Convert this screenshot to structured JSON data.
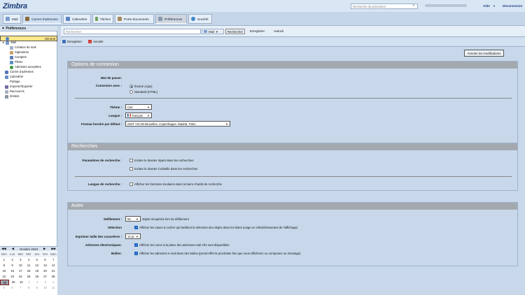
{
  "header": {
    "logo": "Zimbra",
    "people_search_placeholder": "Recherche de personnes",
    "help": "Aide",
    "logout": "Déconnexion"
  },
  "tabs": [
    {
      "label": "Mail",
      "icon": "mail-icon"
    },
    {
      "label": "Carnet d'adresses",
      "icon": "address-book-icon",
      "active": true
    },
    {
      "label": "Calendrier",
      "icon": "calendar-icon"
    },
    {
      "label": "Tâches",
      "icon": "tasks-icon"
    },
    {
      "label": "Porte-documents",
      "icon": "briefcase-icon"
    },
    {
      "label": "Préférences",
      "icon": "preferences-icon"
    },
    {
      "label": "Société",
      "icon": "society-icon"
    }
  ],
  "sidebar": {
    "title": "Préférences",
    "items": [
      {
        "label": "Général",
        "selected": true
      },
      {
        "label": "Mail"
      },
      {
        "label": "Création de mail"
      },
      {
        "label": "Signatures"
      },
      {
        "label": "Comptes"
      },
      {
        "label": "Filtres"
      },
      {
        "label": "Adresses acceptées"
      },
      {
        "label": "Carnet d'adresses"
      },
      {
        "label": "Calendrier"
      },
      {
        "label": "Partage"
      },
      {
        "label": "Importer/Exporter"
      },
      {
        "label": "Raccourcis"
      },
      {
        "label": "Zimlets"
      }
    ]
  },
  "minical": {
    "title": "Octobre 2023",
    "dow": [
      "Dim",
      "Lun",
      "Mar",
      "Mer",
      "Jeu",
      "Ven",
      "Sam"
    ],
    "weeks": [
      [
        "1",
        "2",
        "3",
        "4",
        "5",
        "6",
        "7"
      ],
      [
        "8",
        "9",
        "10",
        "11",
        "12",
        "13",
        "14"
      ],
      [
        "15",
        "16",
        "17",
        "18",
        "19",
        "20",
        "21"
      ],
      [
        "22",
        "23",
        "24",
        "25",
        "26",
        "27",
        "28"
      ],
      [
        "29",
        "30",
        "31",
        "1",
        "2",
        "3",
        "4"
      ],
      [
        "5",
        "6",
        "7",
        "8",
        "9",
        "10",
        "11"
      ]
    ]
  },
  "toolbar": {
    "search_placeholder": "Rechercher",
    "scope": "Mail",
    "search_button": "Rechercher",
    "save_button": "Enregistrer",
    "advanced": "Avancé"
  },
  "actions": {
    "save": "Enregistrer",
    "cancel": "Annuler",
    "undo": "Annuler les modifications"
  },
  "connexion": {
    "title": "Options de connexion",
    "password_label": "Mot de passe:",
    "mode_label": "Connexion avec :",
    "mode_options": [
      "Évolué (Ajax)",
      "Standard (HTML)"
    ],
    "theme_label": "Thème :",
    "theme_value": "Ciel",
    "lang_label": "Langue :",
    "lang_value": "français",
    "tz_label": "Fuseau horaire par défaut :",
    "tz_value": "GMT +01:00 Bruxelles, Copenhague, Madrid, Paris"
  },
  "recherches": {
    "title": "Recherches",
    "params_label": "Paramètres de recherche :",
    "opt_spam": "Inclure le dossier Spam dans les recherches",
    "opt_trash": "Inclure le dossier Corbeille dans les recherches",
    "lang_label": "Langue de recherche :",
    "opt_lang": "Afficher les fonctions évoluées dans la barre d'outils de recherche"
  },
  "autre": {
    "title": "Autre",
    "scroll_label": "Défilement :",
    "scroll_value": "50",
    "scroll_suffix": "objets récupérés lors du défilement",
    "selection_label": "Sélection",
    "selection_text": "Afficher les cases à cocher qui facilitent la sélection des objets dans les listes (exige un rafraîchissement de l'affichage)",
    "print_label": "Imprimer taille des caractères :",
    "print_value": "12 pt",
    "email_label": "Adresses électroniques:",
    "email_text": "Afficher les noms à la place des adresses mail s'ils sont disponibles",
    "bubbles_label": "Bulles:",
    "bubbles_text": "Afficher les adresses e-mail dans des bulles (prend effet la prochaine fois que vous afficherez ou composez un message)"
  }
}
